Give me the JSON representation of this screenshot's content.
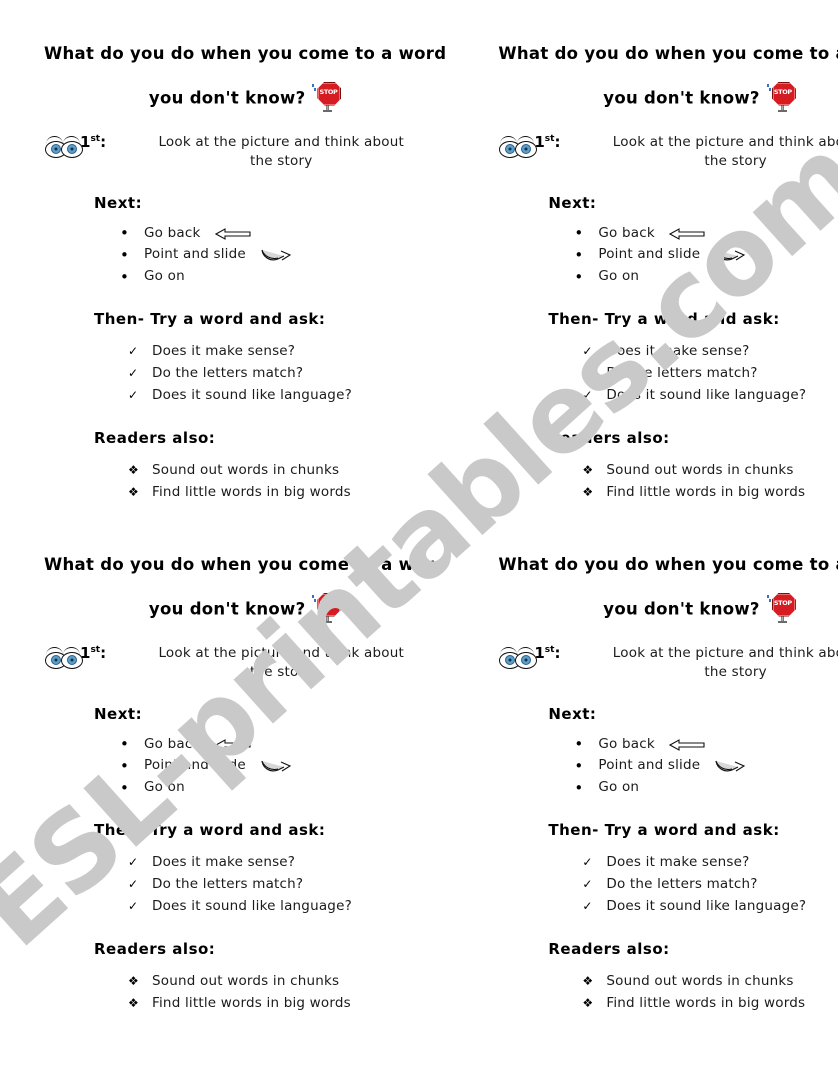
{
  "document": {
    "watermark": "ESL-printables.com",
    "watermark_color": "#c9c9c9",
    "background_color": "#ffffff",
    "text_color": "#1b1b1b",
    "stop_sign_color": "#d41c22",
    "eye_iris_color": "#5d9ec9"
  },
  "worksheet": {
    "title_line1": "What do you do when you come to a word",
    "title_line2": "you don't know?",
    "stop_sign_label": "STOP",
    "first_step": {
      "ordinal_number": "1",
      "ordinal_suffix": "st",
      "ordinal_colon": ":",
      "text_line1": "Look at the picture and think about",
      "text_line2": "the story"
    },
    "next_heading": "Next:",
    "next_items": [
      {
        "bullet": "•",
        "label": "Go back",
        "icon": "left-arrow-icon"
      },
      {
        "bullet": "•",
        "label": "Point and slide",
        "icon": "curved-arrow-icon"
      },
      {
        "bullet": "•",
        "label": "Go on",
        "icon": ""
      }
    ],
    "then_heading": "Then-  Try a word and ask:",
    "then_items": [
      {
        "bullet": "✓",
        "label": "Does it make sense?"
      },
      {
        "bullet": "✓",
        "label": "Do the letters match?"
      },
      {
        "bullet": "✓",
        "label": "Does it sound like language?"
      }
    ],
    "readers_heading": "Readers also:",
    "readers_items": [
      {
        "bullet": "❖",
        "label": "Sound out words in chunks"
      },
      {
        "bullet": "❖",
        "label": "Find little words in big words"
      }
    ]
  },
  "copies": [
    {
      "id": "copy-top-left"
    },
    {
      "id": "copy-top-right"
    },
    {
      "id": "copy-bottom-left"
    },
    {
      "id": "copy-bottom-right"
    }
  ]
}
